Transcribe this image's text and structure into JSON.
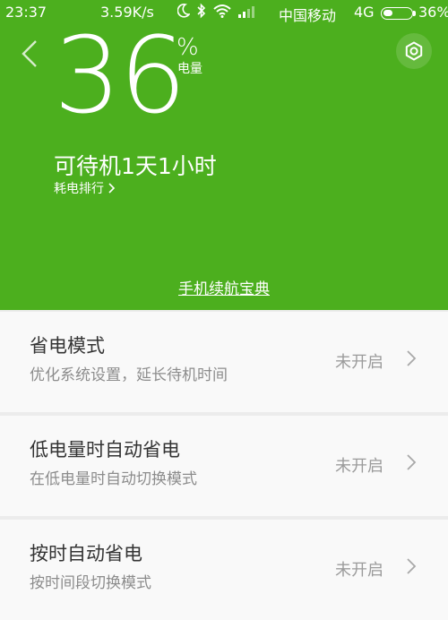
{
  "status_bar": {
    "time": "23:37",
    "speed": "3.59K/s",
    "carrier": "中国移动",
    "network": "4G",
    "battery_percent_text": "36%",
    "battery_level": 0.36,
    "icons": [
      "moon-icon",
      "bluetooth-icon",
      "wifi-icon",
      "signal-icon"
    ]
  },
  "header": {
    "battery_value": "36",
    "percent_sign": "%",
    "battery_label": "电量",
    "standby_text": "可待机1天1小时",
    "ranking_link": "耗电排行",
    "guide_link": "手机续航宝典"
  },
  "settings": [
    {
      "title": "省电模式",
      "description": "优化系统设置，延长待机时间",
      "state": "未开启"
    },
    {
      "title": "低电量时自动省电",
      "description": "在低电量时自动切换模式",
      "state": "未开启"
    },
    {
      "title": "按时自动省电",
      "description": "按时间段切换模式",
      "state": "未开启"
    }
  ],
  "colors": {
    "accent": "#4caf1e",
    "background": "#ececec",
    "card": "#f9f9f9",
    "title_text": "#333333",
    "secondary_text": "#8c8c8c"
  }
}
